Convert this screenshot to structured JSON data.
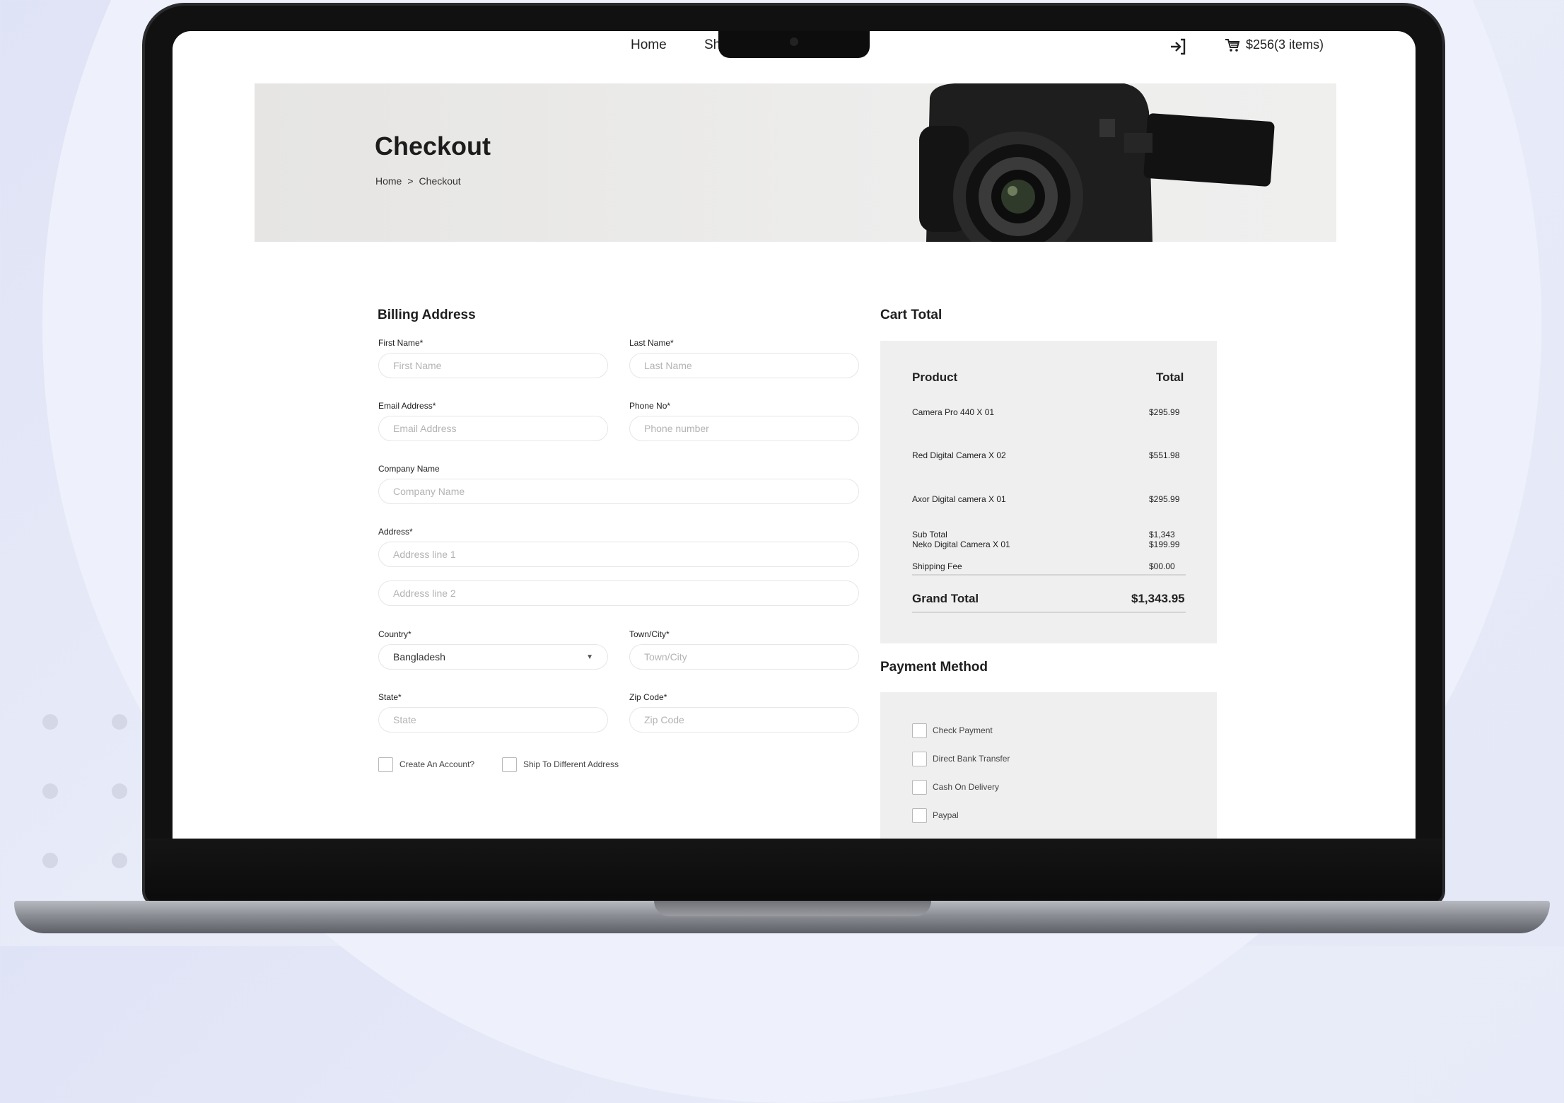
{
  "nav": {
    "home": "Home",
    "shop": "Sh",
    "cart_summary": "$256(3 items)"
  },
  "banner": {
    "title": "Checkout",
    "breadcrumb": [
      "Home",
      ">",
      "Checkout"
    ]
  },
  "billing": {
    "title": "Billing Address",
    "first_name_label": "First Name*",
    "first_name_placeholder": "First Name",
    "last_name_label": "Last Name*",
    "last_name_placeholder": "Last Name",
    "email_label": "Email Address*",
    "email_placeholder": "Email Address",
    "phone_label": "Phone No*",
    "phone_placeholder": "Phone number",
    "company_label": "Company Name",
    "company_placeholder": "Company Name",
    "address_label": "Address*",
    "address1_placeholder": "Address line 1",
    "address2_placeholder": "Address line 2",
    "country_label": "Country*",
    "country_value": "Bangladesh",
    "town_label": "Town/City*",
    "town_placeholder": "Town/City",
    "state_label": "State*",
    "state_placeholder": "State",
    "zip_label": "Zip Code*",
    "zip_placeholder": "Zip Code",
    "create_account": "Create An Account?",
    "ship_different": "Ship To Different Address"
  },
  "cart": {
    "title": "Cart Total",
    "col_product": "Product",
    "col_total": "Total",
    "items": [
      {
        "name": "Camera Pro 440 X 01",
        "total": "$295.99"
      },
      {
        "name": "Red Digital Camera X 02",
        "total": "$551.98"
      },
      {
        "name": "Axor Digital camera X 01",
        "total": "$295.99"
      },
      {
        "name": "Neko Digital Camera X 01",
        "total": "$199.99"
      }
    ],
    "subtotal_label": "Sub Total",
    "subtotal_value": "$1,343",
    "shipping_label": "Shipping Fee",
    "shipping_value": "$00.00",
    "grand_label": "Grand Total",
    "grand_value": "$1,343.95"
  },
  "payment": {
    "title": "Payment Method",
    "options": [
      "Check Payment",
      "Direct Bank Transfer",
      "Cash On Delivery",
      "Paypal"
    ]
  },
  "colors": {
    "panel_bg": "#efefef",
    "text": "#222222"
  }
}
